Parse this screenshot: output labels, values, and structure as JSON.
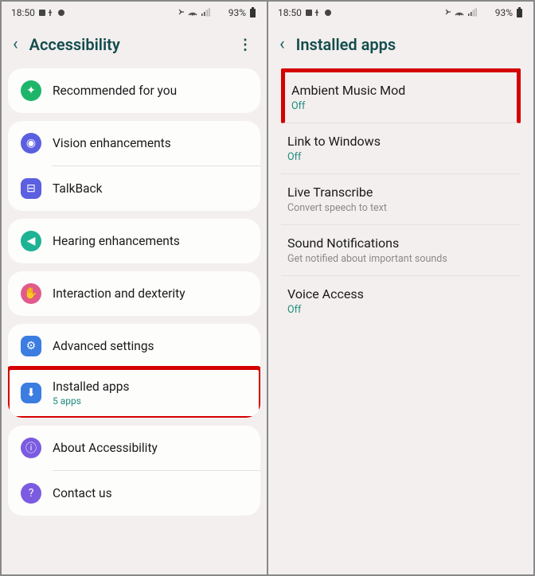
{
  "status": {
    "time": "18:50",
    "battery": "93%"
  },
  "screen1": {
    "title": "Accessibility",
    "groups": [
      {
        "items": [
          {
            "icon": "recommended-icon",
            "bg": "#1eb56a",
            "shape": "circle",
            "label": "Recommended for you"
          }
        ]
      },
      {
        "items": [
          {
            "icon": "vision-icon",
            "bg": "#5b5fe0",
            "shape": "circle",
            "label": "Vision enhancements"
          },
          {
            "icon": "talkback-icon",
            "bg": "#5b5fe0",
            "shape": "rounded",
            "label": "TalkBack"
          }
        ]
      },
      {
        "items": [
          {
            "icon": "hearing-icon",
            "bg": "#1db394",
            "shape": "circle",
            "label": "Hearing enhancements"
          }
        ]
      },
      {
        "items": [
          {
            "icon": "interaction-icon",
            "bg": "#e05b8b",
            "shape": "circle",
            "label": "Interaction and dexterity"
          }
        ]
      },
      {
        "items": [
          {
            "icon": "advanced-icon",
            "bg": "#3b7de0",
            "shape": "rounded",
            "label": "Advanced settings"
          },
          {
            "icon": "installed-icon",
            "bg": "#3b7de0",
            "shape": "rounded",
            "label": "Installed apps",
            "sub": "5 apps",
            "highlight": true
          }
        ]
      },
      {
        "items": [
          {
            "icon": "about-icon",
            "bg": "#7b5be0",
            "shape": "circle",
            "label": "About Accessibility"
          },
          {
            "icon": "contact-icon",
            "bg": "#7b5be0",
            "shape": "circle",
            "label": "Contact us"
          }
        ]
      }
    ]
  },
  "screen2": {
    "title": "Installed apps",
    "items": [
      {
        "label": "Ambient Music Mod",
        "sub": "Off",
        "subColor": "teal",
        "highlight": true
      },
      {
        "label": "Link to Windows",
        "sub": "Off",
        "subColor": "teal"
      },
      {
        "label": "Live Transcribe",
        "sub": "Convert speech to text",
        "subColor": "gray"
      },
      {
        "label": "Sound Notifications",
        "sub": "Get notified about important sounds",
        "subColor": "gray"
      },
      {
        "label": "Voice Access",
        "sub": "Off",
        "subColor": "teal"
      }
    ]
  },
  "iconGlyphs": {
    "recommended-icon": "✦",
    "vision-icon": "◉",
    "talkback-icon": "⊟",
    "hearing-icon": "◀",
    "interaction-icon": "✋",
    "advanced-icon": "⚙",
    "installed-icon": "⬇",
    "about-icon": "ⓘ",
    "contact-icon": "?"
  }
}
